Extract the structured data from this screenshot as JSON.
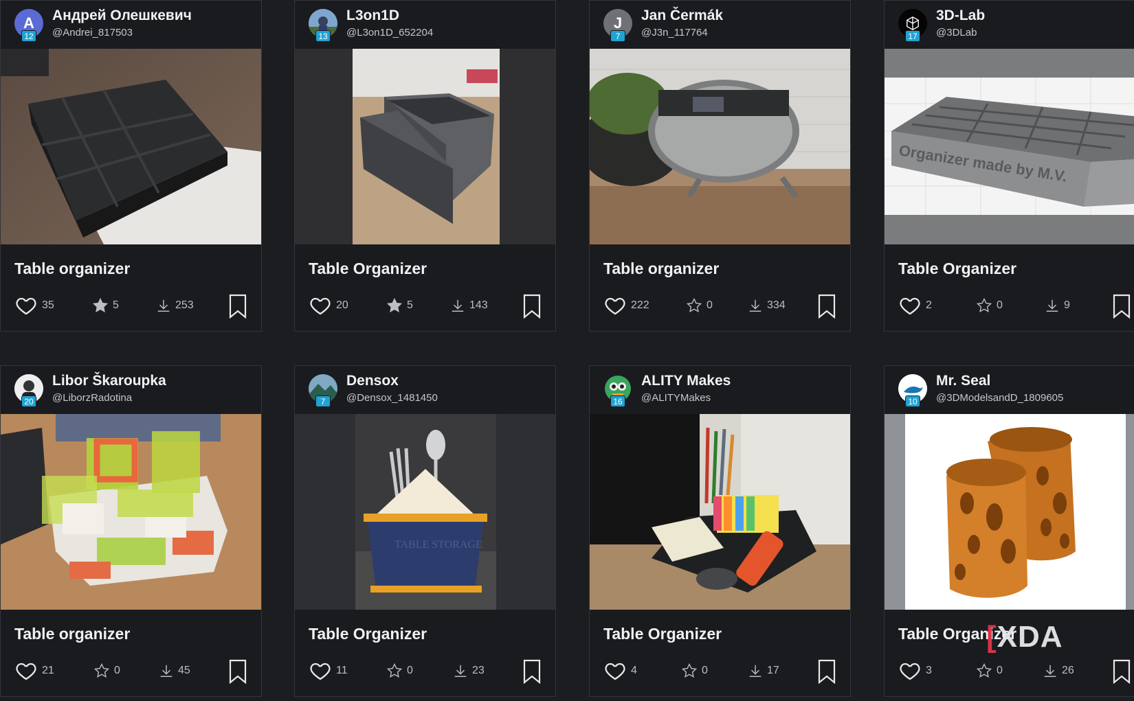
{
  "cards": [
    {
      "author": "Андрей Олешкевич",
      "handle": "@Andrei_817503",
      "level": "12",
      "avatar_letter": "A",
      "title": "Table organizer",
      "likes": "35",
      "ratings": "5",
      "downloads": "253",
      "rating_filled": true
    },
    {
      "author": "L3on1D",
      "handle": "@L3on1D_652204",
      "level": "13",
      "avatar_letter": "",
      "title": "Table Organizer",
      "likes": "20",
      "ratings": "5",
      "downloads": "143",
      "rating_filled": true
    },
    {
      "author": "Jan Čermák",
      "handle": "@J3n_117764",
      "level": "7",
      "avatar_letter": "J",
      "title": "Table organizer",
      "likes": "222",
      "ratings": "0",
      "downloads": "334",
      "rating_filled": false
    },
    {
      "author": "3D-Lab",
      "handle": "@3DLab",
      "level": "17",
      "avatar_letter": "",
      "title": "Table Organizer",
      "likes": "2",
      "ratings": "0",
      "downloads": "9",
      "rating_filled": false,
      "thumb_text": "Organizer made by M.V."
    },
    {
      "author": "Libor Škaroupka",
      "handle": "@LiborzRadotina",
      "level": "20",
      "avatar_letter": "",
      "title": "Table organizer",
      "likes": "21",
      "ratings": "0",
      "downloads": "45",
      "rating_filled": false
    },
    {
      "author": "Densox",
      "handle": "@Densox_1481450",
      "level": "7",
      "avatar_letter": "",
      "title": "Table Organizer",
      "likes": "11",
      "ratings": "0",
      "downloads": "23",
      "rating_filled": false,
      "thumb_text": "TABLE STORAGE"
    },
    {
      "author": "ALITY Makes",
      "handle": "@ALITYMakes",
      "level": "16",
      "avatar_letter": "",
      "title": "Table Organizer",
      "likes": "4",
      "ratings": "0",
      "downloads": "17",
      "rating_filled": false
    },
    {
      "author": "Mr. Seal",
      "handle": "@3DModelsandD_1809605",
      "level": "10",
      "avatar_letter": "",
      "title": "Table Organizer",
      "likes": "3",
      "ratings": "0",
      "downloads": "26",
      "rating_filled": false
    }
  ],
  "watermark": {
    "text": "XDA"
  },
  "colors": {
    "background": "#1c1d21",
    "card": "#1a1b1f",
    "level_badge": "#1fa3d3",
    "text": "#f1f1f3",
    "muted": "#bdbec3"
  },
  "icons": {
    "like": "heart-icon",
    "rating": "star-icon",
    "download": "download-icon",
    "save": "bookmark-icon"
  }
}
